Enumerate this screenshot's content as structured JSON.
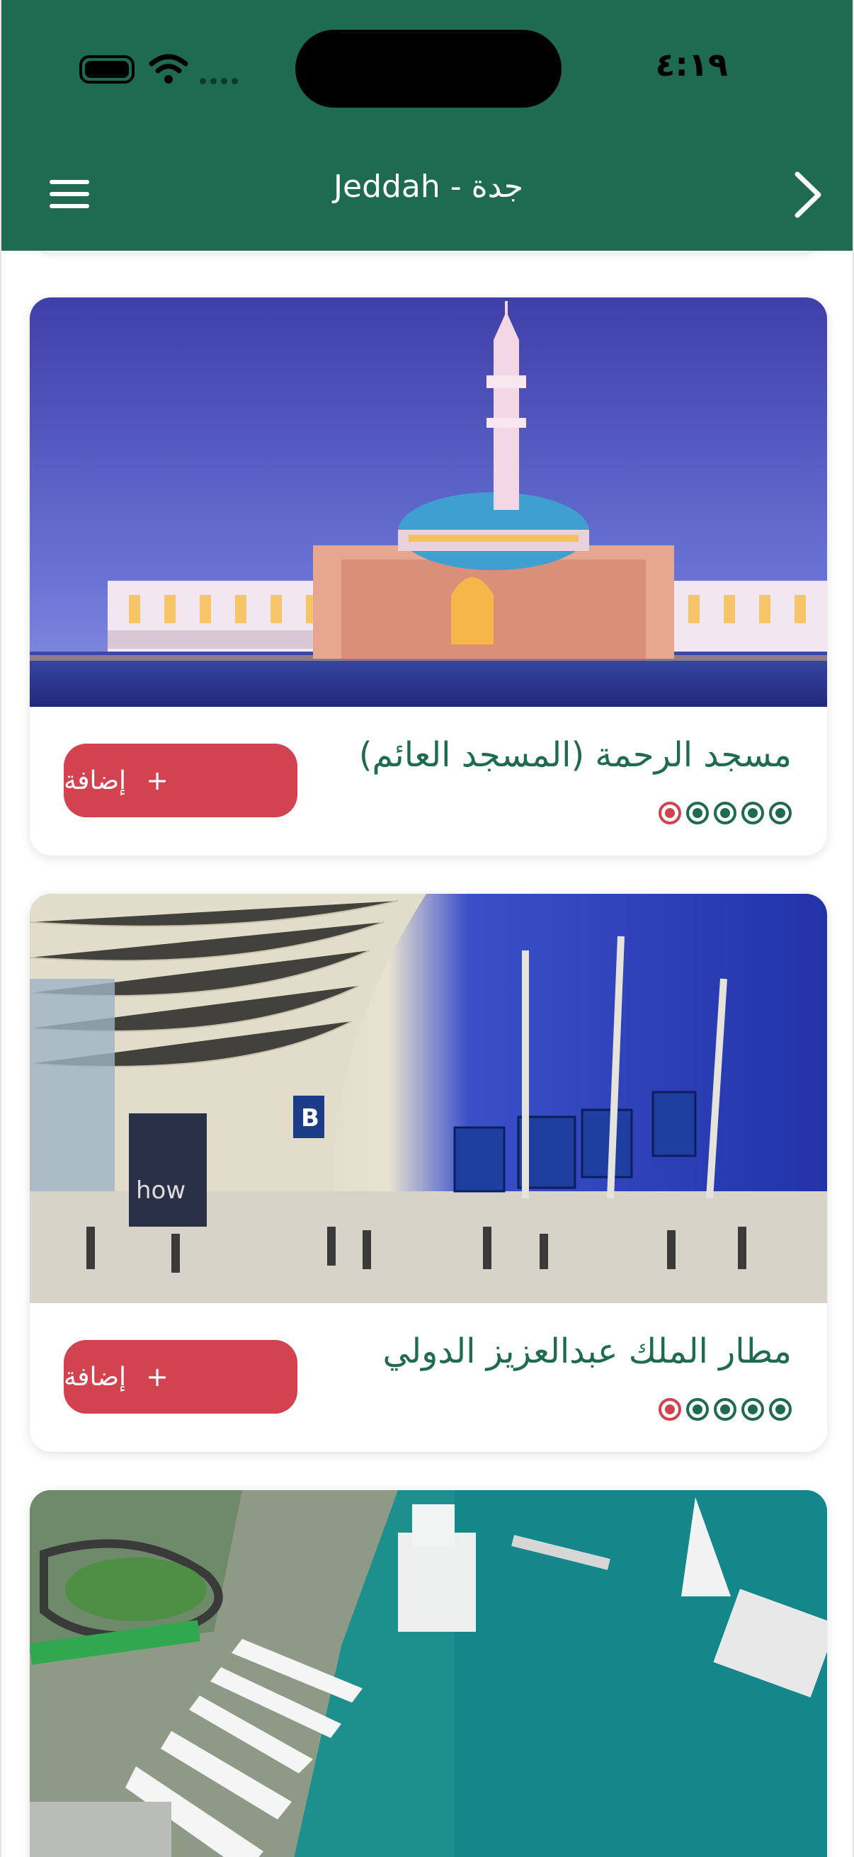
{
  "status_bar": {
    "time": "٤:١٩"
  },
  "header": {
    "title": "Jeddah - جدة",
    "menu_icon": "menu-icon",
    "forward_icon": "chevron-right-icon"
  },
  "colors": {
    "primary": "#1e6b52",
    "accent": "#d2434f",
    "background": "#ffffff"
  },
  "places": [
    {
      "title": "مسجد الرحمة (المسجد العائم)",
      "add_label": "إضافة",
      "add_icon": "+",
      "rating": 4,
      "rating_max": 5,
      "image": "floating-mosque-photo"
    },
    {
      "title": "مطار الملك عبدالعزيز الدولي",
      "add_label": "إضافة",
      "add_icon": "+",
      "rating": 4,
      "rating_max": 5,
      "image": "airport-terminal-photo"
    },
    {
      "image": "jeddah-waterfront-marina-photo"
    }
  ]
}
